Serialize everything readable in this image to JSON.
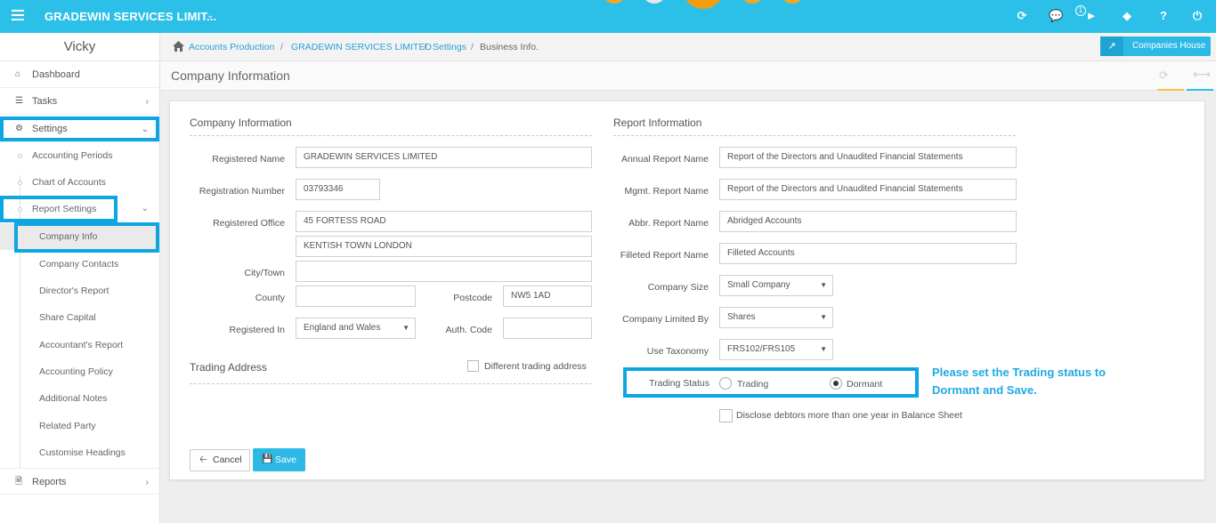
{
  "app": {
    "title": "GRADEWIN SERVICES LIMIT...",
    "notification_count": "1"
  },
  "sidebar": {
    "user": "Vicky",
    "items": [
      {
        "label": "Dashboard"
      },
      {
        "label": "Tasks"
      },
      {
        "label": "Settings"
      },
      {
        "label": "Accounting Periods"
      },
      {
        "label": "Chart of Accounts"
      },
      {
        "label": "Report Settings"
      },
      {
        "label": "Company Info"
      },
      {
        "label": "Company Contacts"
      },
      {
        "label": "Director's Report"
      },
      {
        "label": "Share Capital"
      },
      {
        "label": "Accountant's Report"
      },
      {
        "label": "Accounting Policy"
      },
      {
        "label": "Additional Notes"
      },
      {
        "label": "Related Party"
      },
      {
        "label": "Customise Headings"
      },
      {
        "label": "Reports"
      }
    ]
  },
  "breadcrumb": [
    "Accounts Production",
    "GRADEWIN SERVICES LIMITED",
    "Settings",
    "Business Info."
  ],
  "companies_house_label": "Companies House",
  "page_title": "Company Information",
  "company": {
    "section_title": "Company Information",
    "registered_name_label": "Registered Name",
    "registered_name": "GRADEWIN SERVICES LIMITED",
    "registration_number_label": "Registration Number",
    "registration_number": "03793346",
    "registered_office_label": "Registered Office",
    "address1": "45 FORTESS ROAD",
    "address2": "KENTISH TOWN LONDON",
    "city_label": "City/Town",
    "city": "",
    "county_label": "County",
    "county": "",
    "postcode_label": "Postcode",
    "postcode": "NW5 1AD",
    "registered_in_label": "Registered In",
    "registered_in": "England and Wales",
    "auth_code_label": "Auth. Code",
    "auth_code": "",
    "trading_address_title": "Trading Address",
    "different_trading_label": "Different trading address"
  },
  "report": {
    "section_title": "Report Information",
    "annual_label": "Annual Report Name",
    "annual": "Report of the Directors and Unaudited Financial Statements",
    "mgmt_label": "Mgmt. Report Name",
    "mgmt": "Report of the Directors and Unaudited Financial Statements",
    "abbr_label": "Abbr. Report Name",
    "abbr": "Abridged Accounts",
    "filleted_label": "Filleted Report Name",
    "filleted": "Filleted Accounts",
    "size_label": "Company Size",
    "size": "Small Company",
    "limited_label": "Company Limited By",
    "limited": "Shares",
    "taxonomy_label": "Use Taxonomy",
    "taxonomy": "FRS102/FRS105",
    "trading_status_label": "Trading Status",
    "trading_option": "Trading",
    "dormant_option": "Dormant",
    "disclose_label": "Disclose debtors more than one year in Balance Sheet"
  },
  "instruction": "Please set the Trading status to Dormant and Save.",
  "buttons": {
    "cancel": "Cancel",
    "save": "Save"
  },
  "colors": {
    "accent": "#2cc0e8",
    "highlight": "#0ea6e2",
    "instruction": "#1fa9e1"
  }
}
